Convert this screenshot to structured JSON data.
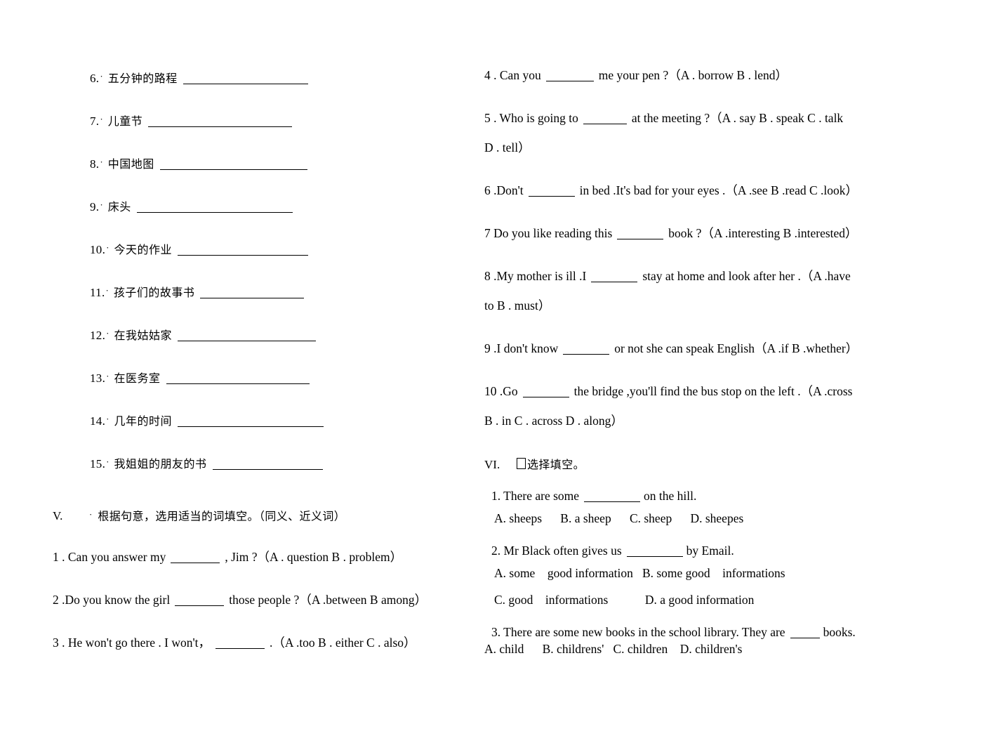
{
  "page": {
    "background": "#ffffff",
    "text_color": "#000000"
  },
  "left_column": {
    "translation_items": [
      {
        "num": "6.",
        "bullet": "·",
        "cn": "五分钟的路程",
        "blank_width": 178
      },
      {
        "num": "7.",
        "bullet": "·",
        "cn": "儿童节",
        "blank_width": 205
      },
      {
        "num": "8.",
        "bullet": "·",
        "cn": "中国地图",
        "blank_width": 210
      },
      {
        "num": "9.",
        "bullet": "·",
        "cn": "床头",
        "blank_width": 222
      },
      {
        "num": "10.",
        "bullet": "·",
        "cn": "今天的作业",
        "blank_width": 186
      },
      {
        "num": "11.",
        "bullet": "·",
        "cn": "孩子们的故事书",
        "blank_width": 148
      },
      {
        "num": "12.",
        "bullet": "·",
        "cn": "在我姑姑家",
        "blank_width": 197
      },
      {
        "num": "13.",
        "bullet": "·",
        "cn": "在医务室",
        "blank_width": 204
      },
      {
        "num": "14.",
        "bullet": "·",
        "cn": "几年的时间",
        "blank_width": 208
      },
      {
        "num": "15.",
        "bullet": "·",
        "cn": "我姐姐的朋友的书",
        "blank_width": 157
      }
    ],
    "section_v": {
      "numeral": "V.",
      "bullet": "·",
      "title": "根据句意，选用适当的词填空。（同义、近义词）"
    },
    "section_v_questions": [
      {
        "before": "1 . Can you answer my",
        "blank_width": 70,
        "after": ", Jim  ?（A . question B . problem）"
      },
      {
        "before": "2 .Do you know the girl",
        "blank_width": 70,
        "after": "those people ?（A .between B  among）"
      },
      {
        "before": "3 . He won't go there . I won't，",
        "blank_width": 70,
        "after": ".（A .too B . either C . also）"
      }
    ]
  },
  "right_column": {
    "section_v_questions": [
      {
        "before": "4 . Can you",
        "blank_width": 68,
        "after": "me your pen ?（A . borrow B . lend）",
        "continuation": ""
      },
      {
        "before": "5 . Who is going to",
        "blank_width": 62,
        "after": "at the meeting ?（A . say B . speak C . talk",
        "continuation": "D . tell）"
      },
      {
        "before": "6 .Don't",
        "blank_width": 66,
        "after": "in bed .It's bad for your eyes .（A .see B .read C .look）",
        "continuation": ""
      },
      {
        "before": "7  Do you like reading this",
        "blank_width": 66,
        "after": "book ?（A  .interesting B  .interested）",
        "continuation": ""
      },
      {
        "before": "8 .My mother is ill .I",
        "blank_width": 66,
        "after": "stay at home and look after her .（A .have",
        "continuation": "to B . must）"
      },
      {
        "before": "9 .I don't know",
        "blank_width": 66,
        "after": "or not she can speak English（A .if B .whether）",
        "continuation": ""
      },
      {
        "before": "10 .Go",
        "blank_width": 66,
        "after": "the bridge ,you'll find the bus stop on the left .（A .cross",
        "continuation": "B . in C . across D . along）"
      }
    ],
    "section_vi": {
      "numeral": "VI.",
      "tofu": "□",
      "title": "选择填空。"
    },
    "section_vi_questions": [
      {
        "stem_before": "1. There are some",
        "blank_width": 80,
        "stem_after": "on the hill.",
        "options_line1": "A. sheeps      B. a sheep      C. sheep      D. sheepes",
        "options_line2": ""
      },
      {
        "stem_before": "2. Mr Black often gives us",
        "blank_width": 80,
        "stem_after": "by Email.",
        "options_line1": "A. some    good information   B. some good    informations",
        "options_line2": "C. good    informations            D. a good information"
      },
      {
        "stem_before": "3. There are some new books in the school library. They are",
        "blank_width": 42,
        "stem_after": "books.",
        "options_line1": "A. child      B. childrens'   C. children    D. children's",
        "options_line2": ""
      }
    ]
  }
}
